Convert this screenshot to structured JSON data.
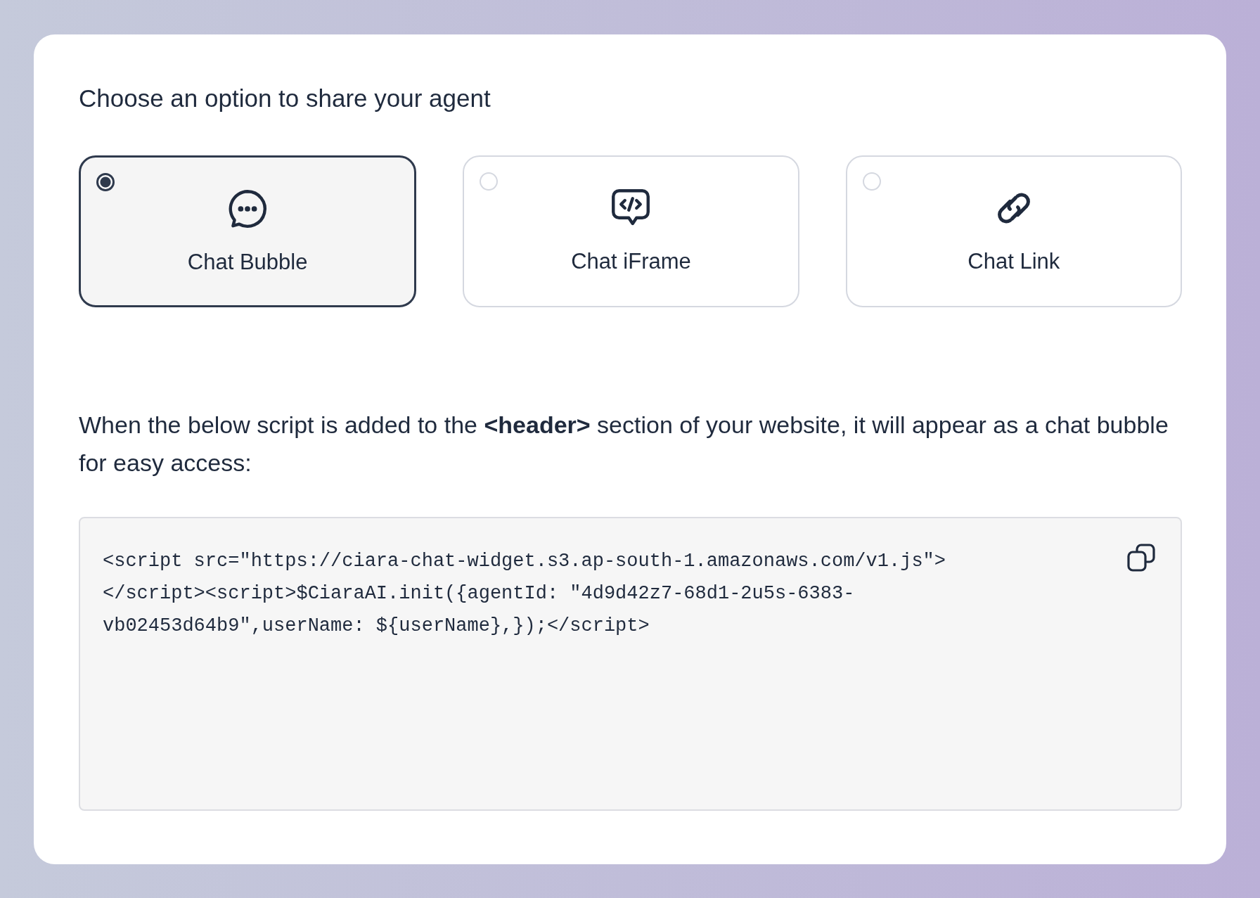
{
  "heading": "Choose an option to share your agent",
  "options": [
    {
      "kind": "bubble",
      "label": "Chat Bubble",
      "selected": true
    },
    {
      "kind": "iframe",
      "label": "Chat iFrame",
      "selected": false
    },
    {
      "kind": "link",
      "label": "Chat Link",
      "selected": false
    }
  ],
  "description": "When the below script is added to the **<header>** section of your website, it will appear as a chat bubble for easy access:",
  "code": "<script src=\"https://ciara-chat-widget.s3.ap-south-1.amazonaws.com/v1.js\"></script><script>$CiaraAI.init({agentId: \"4d9d42z7-68d1-2u5s-6383-vb02453d64b9\",userName: ${userName},});</script>"
}
